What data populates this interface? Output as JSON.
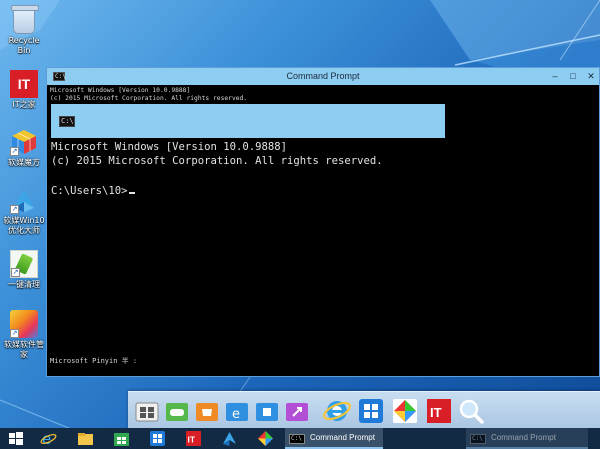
{
  "desktop": {
    "icons": [
      {
        "id": "recycle-bin",
        "label": "Recycle Bin",
        "icon": "recycle-bin-icon"
      },
      {
        "id": "ithome",
        "label": "IT之家",
        "icon": "ithome-logo-icon",
        "glyph": "IT"
      },
      {
        "id": "rubik",
        "label": "软媒魔方",
        "icon": "rubik-cube-icon"
      },
      {
        "id": "win10",
        "label": "软媒Win10优化大师",
        "icon": "win10-optimizer-icon"
      },
      {
        "id": "clean",
        "label": "一键清理",
        "icon": "broom-icon"
      },
      {
        "id": "manager",
        "label": "软媒软件管家",
        "icon": "software-manager-icon"
      }
    ],
    "shortcut_arrow": "↗"
  },
  "cmd_window": {
    "title": "Command Prompt",
    "icon_glyph": "C:\\",
    "controls": {
      "minimize": "–",
      "maximize": "□",
      "close": "✕"
    },
    "small_lines": [
      "Microsoft Windows [Version 10.0.9888]",
      "(c) 2015 Microsoft Corporation. All rights reserved."
    ],
    "magnified_lines": [
      "Microsoft Windows [Version 10.0.9888]",
      "(c) 2015 Microsoft Corporation. All rights reserved."
    ],
    "prompt": "C:\\Users\\10>",
    "ime_status": "Microsoft Pinyin 半 :"
  },
  "dock": {
    "items": [
      {
        "id": "folder-grid",
        "icon": "folder-grid-icon"
      },
      {
        "id": "games",
        "icon": "gamepad-folder-icon"
      },
      {
        "id": "store-folder",
        "icon": "shopping-folder-icon"
      },
      {
        "id": "ie-folder",
        "icon": "ie-folder-icon"
      },
      {
        "id": "tools-folder",
        "icon": "tools-folder-icon"
      },
      {
        "id": "rm-folder",
        "icon": "rm-folder-icon"
      },
      {
        "id": "ie",
        "icon": "internet-explorer-icon"
      },
      {
        "id": "software",
        "icon": "software-box-icon"
      },
      {
        "id": "shapes",
        "icon": "color-shapes-icon"
      },
      {
        "id": "ithome",
        "icon": "ithome-logo-icon",
        "glyph": "IT"
      },
      {
        "id": "magnifier",
        "icon": "magnifier-icon"
      }
    ]
  },
  "taskbar": {
    "start_icon": "windows-start-icon",
    "items": [
      {
        "id": "ie",
        "icon": "internet-explorer-icon"
      },
      {
        "id": "explorer",
        "icon": "file-explorer-icon"
      },
      {
        "id": "store",
        "icon": "store-icon"
      },
      {
        "id": "software",
        "icon": "software-box-icon"
      },
      {
        "id": "ithome",
        "icon": "ithome-logo-icon",
        "glyph": "IT"
      },
      {
        "id": "win10",
        "icon": "win10-optimizer-icon"
      },
      {
        "id": "shapes",
        "icon": "color-shapes-icon"
      }
    ],
    "active": [
      {
        "label": "Command Prompt",
        "icon_glyph": "C:\\"
      },
      {
        "label": "Command Prompt",
        "icon_glyph": "C:\\"
      }
    ]
  },
  "colors": {
    "title_bar": "#8ecdf2",
    "console_bg": "#000000",
    "console_text": "#d6d6d6",
    "taskbar": "#122a44"
  }
}
